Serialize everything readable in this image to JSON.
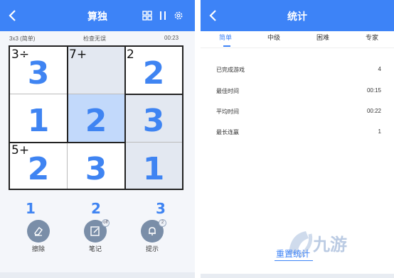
{
  "left": {
    "title": "算独",
    "info": {
      "size": "3x3 (简单)",
      "status": "检查无误",
      "time": "00:23"
    },
    "grid": {
      "values": [
        [
          "3",
          "",
          ""
        ],
        [
          "1",
          "2",
          "3"
        ],
        [
          "2",
          "3",
          "1"
        ]
      ],
      "values_full": [
        [
          "3",
          "",
          "2"
        ],
        [
          "1",
          "2",
          "3"
        ],
        [
          "2",
          "3",
          "1"
        ]
      ],
      "clues": [
        {
          "row": 0,
          "col": 0,
          "text": "3÷"
        },
        {
          "row": 0,
          "col": 1,
          "text": "7+"
        },
        {
          "row": 0,
          "col": 2,
          "text": "2"
        },
        {
          "row": 2,
          "col": 0,
          "text": "5+"
        }
      ],
      "cell_colors": {
        "white": "#ffffff",
        "grey": "#e3e8f1",
        "selected": "#c2d9fb"
      }
    },
    "number_buttons": [
      "1",
      "2",
      "3"
    ],
    "tools": [
      {
        "label": "擦除",
        "icon": "eraser-icon"
      },
      {
        "label": "笔记",
        "icon": "notes-icon",
        "badge": "off"
      },
      {
        "label": "提示",
        "icon": "bell-hint-icon",
        "badge": "2"
      }
    ]
  },
  "right": {
    "title": "统计",
    "tabs": [
      "简单",
      "中级",
      "困难",
      "专家"
    ],
    "active_tab": "简单",
    "stats": [
      {
        "label": "已完成游戏",
        "value": "4"
      },
      {
        "label": "最佳时间",
        "value": "00:15"
      },
      {
        "label": "平均时间",
        "value": "00:22"
      },
      {
        "label": "最长连赢",
        "value": "1"
      }
    ],
    "reset_label": "重置统计"
  },
  "watermark": {
    "text": "九游"
  },
  "colors": {
    "accent": "#3d83f7",
    "digit": "#3f84f2",
    "tool": "#7a8ea8"
  }
}
